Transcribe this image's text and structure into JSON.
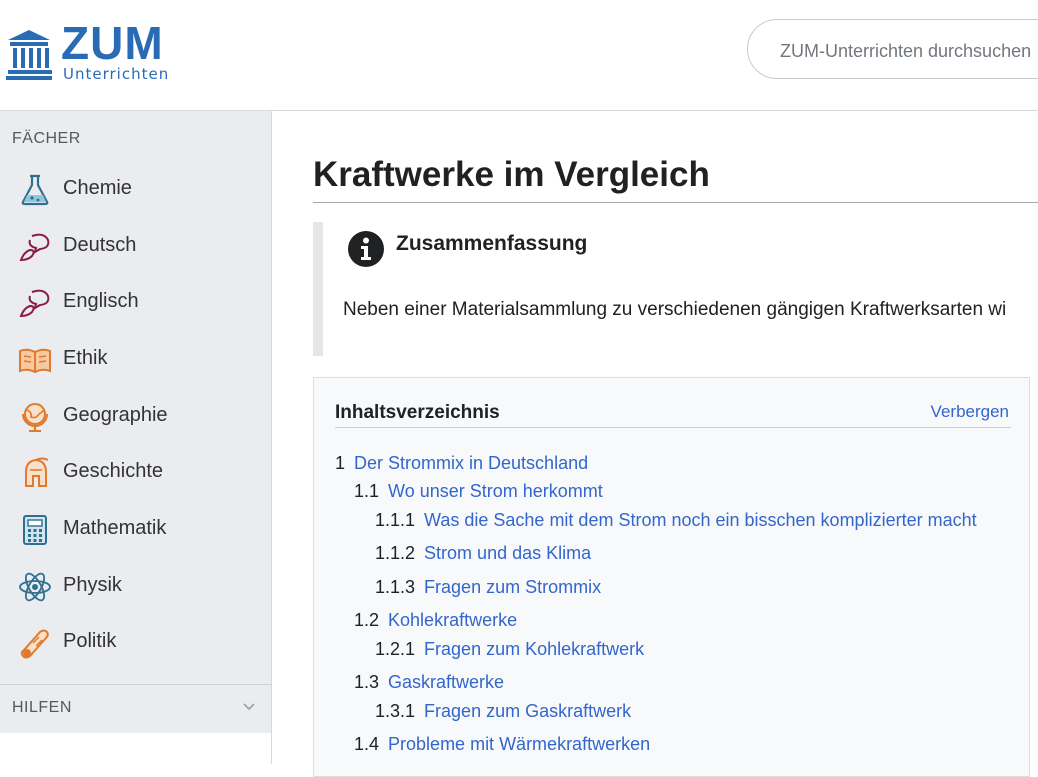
{
  "header": {
    "logo_main": "ZUM",
    "logo_sub": "Unterrichten",
    "search_placeholder": "ZUM-Unterrichten durchsuchen"
  },
  "sidebar": {
    "heading": "FÄCHER",
    "items": [
      {
        "label": "Chemie",
        "icon": "flask-icon"
      },
      {
        "label": "Deutsch",
        "icon": "speech-bubble-icon"
      },
      {
        "label": "Englisch",
        "icon": "speech-bubble-icon"
      },
      {
        "label": "Ethik",
        "icon": "open-book-icon"
      },
      {
        "label": "Geographie",
        "icon": "globe-icon"
      },
      {
        "label": "Geschichte",
        "icon": "helmet-icon"
      },
      {
        "label": "Mathematik",
        "icon": "calculator-icon"
      },
      {
        "label": "Physik",
        "icon": "atom-icon"
      },
      {
        "label": "Politik",
        "icon": "scroll-icon"
      }
    ],
    "hilfen": "HILFEN"
  },
  "main": {
    "title": "Kraftwerke im Vergleich",
    "summary": {
      "title": "Zusammenfassung",
      "text": "Neben einer Materialsammlung zu verschiedenen gängigen Kraftwerksarten wi"
    },
    "toc": {
      "title": "Inhaltsverzeichnis",
      "toggle": "Verbergen",
      "entries": [
        {
          "num": "1",
          "text": "Der Strommix in Deutschland",
          "level": 1
        },
        {
          "num": "1.1",
          "text": "Wo unser Strom herkommt",
          "level": 2
        },
        {
          "num": "1.1.1",
          "text": "Was die Sache mit dem Strom noch ein bisschen komplizierter macht",
          "level": 3
        },
        {
          "num": "1.1.2",
          "text": "Strom und das Klima",
          "level": 3
        },
        {
          "num": "1.1.3",
          "text": "Fragen zum Strommix",
          "level": 3
        },
        {
          "num": "1.2",
          "text": "Kohlekraftwerke",
          "level": 2
        },
        {
          "num": "1.2.1",
          "text": "Fragen zum Kohlekraftwerk",
          "level": 3
        },
        {
          "num": "1.3",
          "text": "Gaskraftwerke",
          "level": 2
        },
        {
          "num": "1.3.1",
          "text": "Fragen zum Gaskraftwerk",
          "level": 3
        },
        {
          "num": "1.4",
          "text": "Probleme mit Wärmekraftwerken",
          "level": 2
        }
      ]
    }
  },
  "colors": {
    "link": "#3366cc",
    "brand": "#2a6bb5",
    "sidebar_bg": "#eaecf0"
  }
}
